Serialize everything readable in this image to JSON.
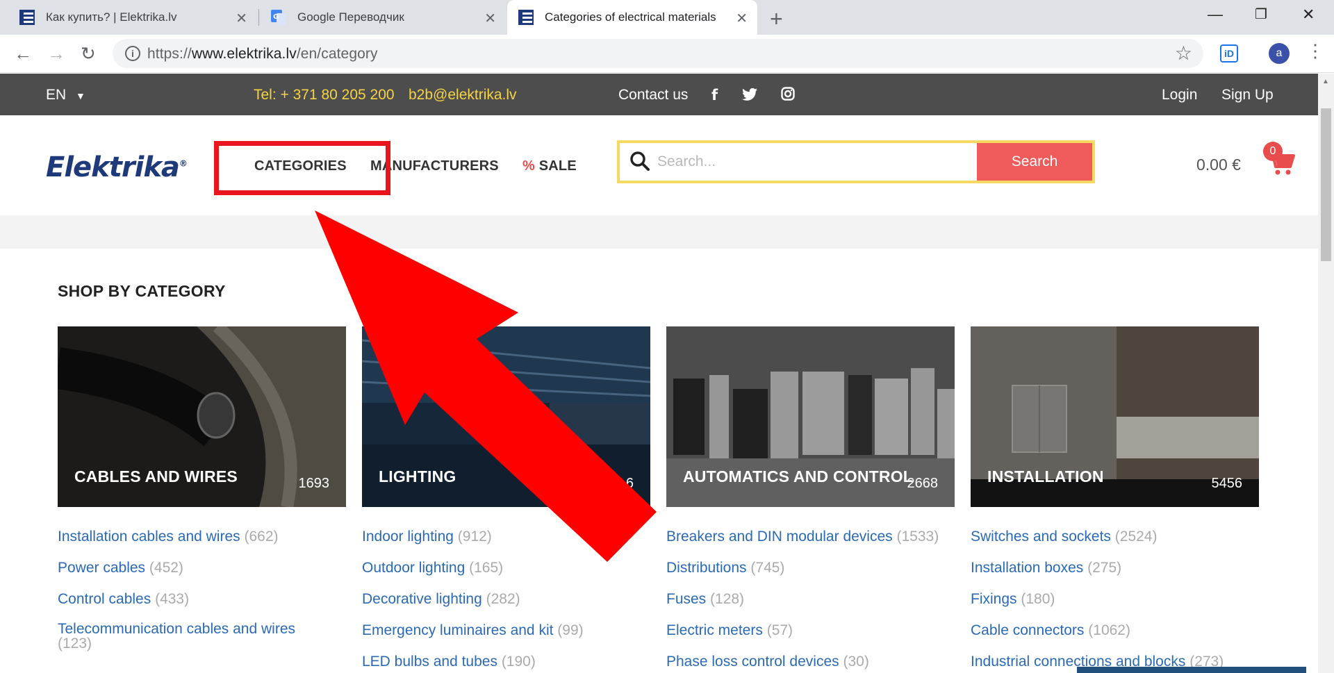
{
  "browser": {
    "tabs": [
      {
        "title": "Как купить? | Elektrika.lv",
        "icon": "elektrika-favicon"
      },
      {
        "title": "Google Переводчик",
        "icon": "google-translate-favicon"
      },
      {
        "title": "Categories of electrical materials",
        "icon": "elektrika-favicon"
      }
    ],
    "url_prefix": "https://",
    "url_host": "www.elektrika.lv",
    "url_path": "/en/category",
    "ext_label": "iD",
    "avatar_letter": "a"
  },
  "topbar": {
    "language": "EN",
    "phone": "Tel: + 371 80 205 200",
    "email": "b2b@elektrika.lv",
    "contact": "Contact us",
    "login": "Login",
    "signup": "Sign Up"
  },
  "header": {
    "logo_text": "Elektrika",
    "nav": {
      "categories": "CATEGORIES",
      "manufacturers": "MANUFACTURERS",
      "sale_symbol": "%",
      "sale": "SALE"
    },
    "search_placeholder": "Search...",
    "search_button": "Search",
    "cart_total": "0.00 €",
    "cart_count": "0"
  },
  "section_title": "SHOP BY CATEGORY",
  "categories": [
    {
      "name": "CABLES AND WIRES",
      "count": "1693",
      "subs": [
        {
          "label": "Installation cables and wires",
          "count": "(662)"
        },
        {
          "label": "Power cables",
          "count": "(452)"
        },
        {
          "label": "Control cables",
          "count": "(433)"
        },
        {
          "label": "Telecommunication cables and wires",
          "count": "(123)"
        }
      ]
    },
    {
      "name": "LIGHTING",
      "count": "6",
      "subs": [
        {
          "label": "Indoor lighting",
          "count": "(912)"
        },
        {
          "label": "Outdoor lighting",
          "count": "(165)"
        },
        {
          "label": "Decorative lighting",
          "count": "(282)"
        },
        {
          "label": "Emergency luminaires and kit",
          "count": "(99)"
        },
        {
          "label": "LED bulbs and tubes",
          "count": "(190)"
        }
      ]
    },
    {
      "name": "AUTOMATICS AND CONTROL",
      "count": "2668",
      "subs": [
        {
          "label": "Breakers and DIN modular devices",
          "count": "(1533)"
        },
        {
          "label": "Distributions",
          "count": "(745)"
        },
        {
          "label": "Fuses",
          "count": "(128)"
        },
        {
          "label": "Electric meters",
          "count": "(57)"
        },
        {
          "label": "Phase loss control devices",
          "count": "(30)"
        }
      ]
    },
    {
      "name": "INSTALLATION",
      "count": "5456",
      "subs": [
        {
          "label": "Switches and sockets",
          "count": "(2524)"
        },
        {
          "label": "Installation boxes",
          "count": "(275)"
        },
        {
          "label": "Fixings",
          "count": "(180)"
        },
        {
          "label": "Cable connectors",
          "count": "(1062)"
        },
        {
          "label": "Industrial connections and blocks",
          "count": "(273)"
        }
      ]
    }
  ],
  "colors": {
    "topbar_bg": "#4d4d4d",
    "accent_yellow": "#f6d443",
    "search_button": "#ef5b5b",
    "link_blue": "#2a6ab5",
    "annotation_red": "#e8151d"
  }
}
